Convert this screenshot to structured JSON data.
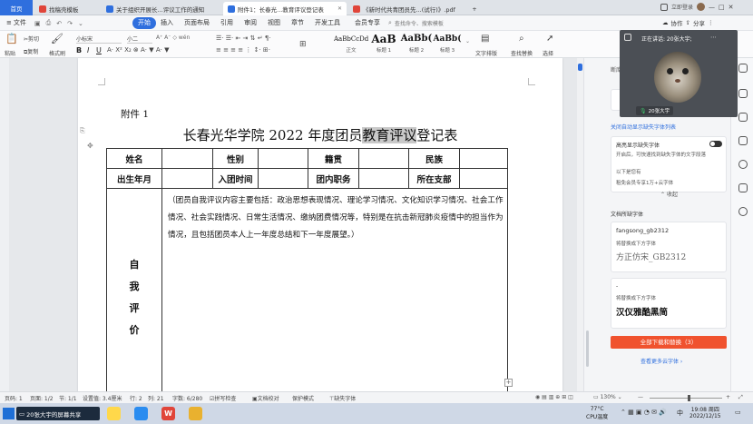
{
  "tabs": [
    {
      "label": "首页"
    },
    {
      "label": "找稿壳模板"
    },
    {
      "label": "关于组织开展长...评议工作的通知"
    },
    {
      "label": "附件1：长春光...教育评议登记表"
    },
    {
      "label": "《新时代共青团员先...(试行)》.pdf"
    }
  ],
  "window_right": {
    "login": "立即登录"
  },
  "menu": {
    "file": "文件",
    "items": [
      "开始",
      "插入",
      "页面布局",
      "引用",
      "审阅",
      "视图",
      "章节",
      "开发工具",
      "会员专享"
    ],
    "search_placeholder": "查找命令、搜索模板",
    "cooperate": "协作",
    "share": "分享"
  },
  "ribbon": {
    "cut": "剪切",
    "copy": "复制",
    "paste": "粘贴",
    "format_painter": "格式刷",
    "font_name": "小标宋",
    "font_size": "小二",
    "bold": "B",
    "italic": "I",
    "underline": "U",
    "styles": [
      {
        "sample": "AaBbCcDd",
        "name": "正文"
      },
      {
        "sample": "AaB",
        "name": "标题 1"
      },
      {
        "sample": "AaBb(",
        "name": "标题 2"
      },
      {
        "sample": "AaBb(",
        "name": "标题 3"
      }
    ],
    "text_layout": "文字排版",
    "find_replace": "查找替换",
    "select": "选择"
  },
  "document": {
    "attachment": "附件 1",
    "title_before": "长春光华学院 2022 年度团员",
    "title_highlight": "教育评议",
    "title_after": "登记表",
    "row1": [
      "姓名",
      "",
      "性别",
      "",
      "籍贯",
      "",
      "民族",
      ""
    ],
    "row2": [
      "出生年月",
      "",
      "入团时间",
      "",
      "团内职务",
      "",
      "所在支部",
      ""
    ],
    "self_eval_label": [
      "自",
      "我",
      "评",
      "价"
    ],
    "self_eval_text": "（团员自我评议内容主要包括：政治思想表现情况、理论学习情况、文化知识学习情况、社会工作情况、社会实践情况、日常生活情况、缴纳团费情况等，特别是在抗击新冠肺炎疫情中的担当作为情况，且包括团员本人上一年度总结和下一年度展望。）"
  },
  "video": {
    "speaking": "正在讲话: 20张大宇;",
    "participant": "20张大宇"
  },
  "panel": {
    "top_label": "断库中",
    "auto_show": "关闭自动显示缺失字体列表",
    "highlight_title": "高亮显示缺失字体",
    "highlight_desc": "开启后，可快速找到缺失字体的文字段落",
    "suggest_label": "以下是您有",
    "member_info": "租免会员专享1万+云字体",
    "collapse": "收起",
    "section_title": "文档所缺字体",
    "fonts": [
      {
        "name": "fangsong_gb2312",
        "replace_label": "将替换成下方字体",
        "preview": "方正仿宋_GB2312"
      },
      {
        "name": "-",
        "replace_label": "将替换成下方字体",
        "preview": "汉仪雅酷黑简"
      }
    ],
    "download_all": "全部下载和替换（3）",
    "view_more": "查看更多云字体"
  },
  "status": {
    "page": "页码: 1",
    "pages": "页面: 1/2",
    "section": "节: 1/1",
    "setting": "设置值: 3.4厘米",
    "row": "行: 2",
    "col": "列: 21",
    "words": "字数: 6/280",
    "spell": "拼写检查",
    "proof": "文档校对",
    "protect": "保护模式",
    "missing_font": "缺失字体",
    "zoom": "130%"
  },
  "taskbar": {
    "app_label": "20张大宇的屏幕共享",
    "weather_temp": "77°C",
    "weather_desc": "CPU温度",
    "ime": "中",
    "time": "19:08 周四",
    "date": "2022/12/15"
  },
  "colors": {
    "accent": "#2f6fde",
    "panel_button": "#f0522e",
    "highlight": "#c9c9c9"
  }
}
